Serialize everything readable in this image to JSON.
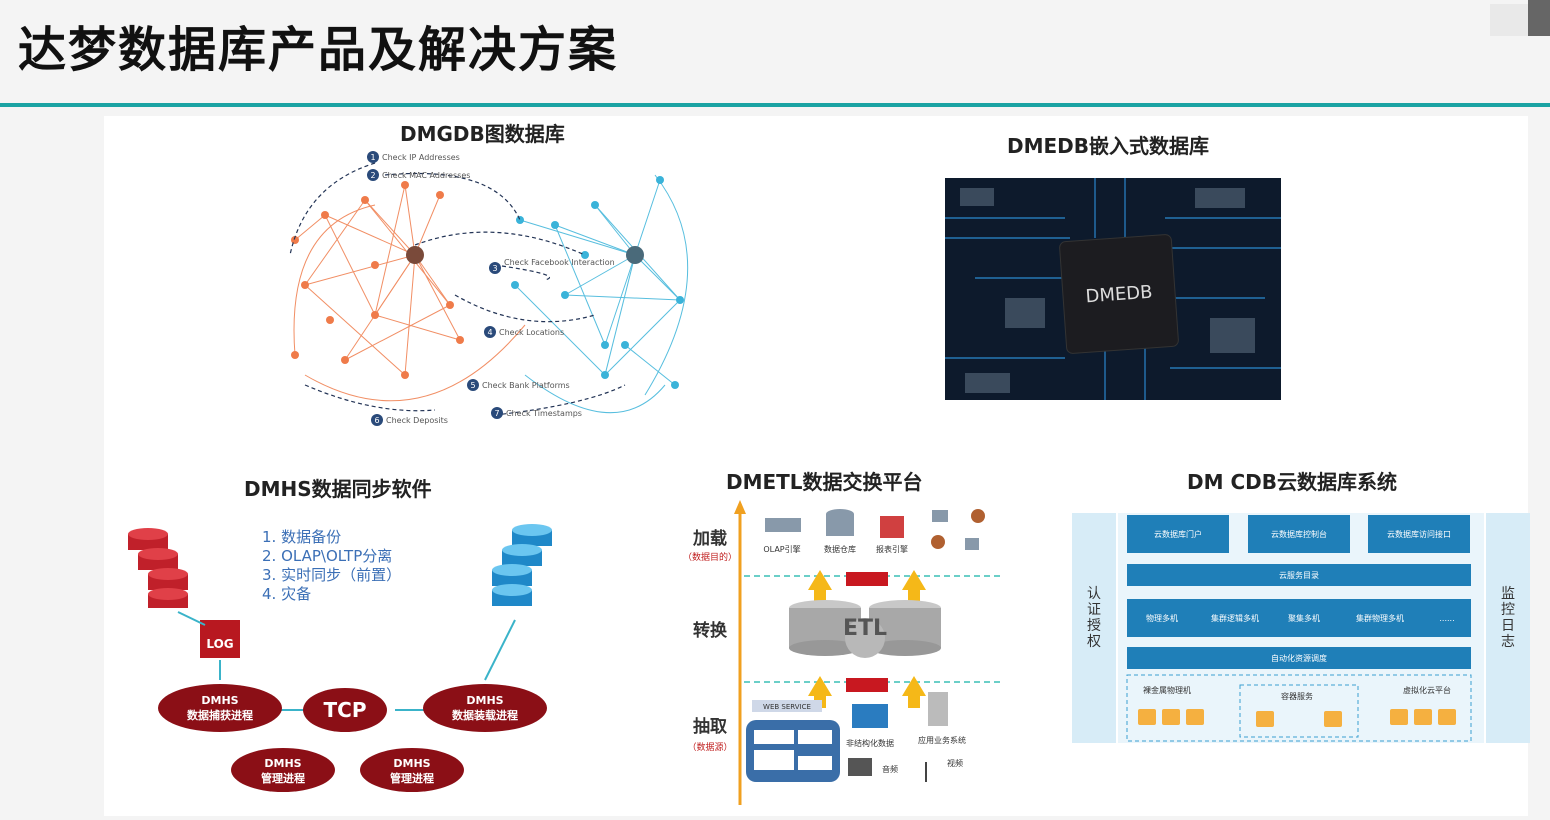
{
  "page": {
    "title": "达梦数据库产品及解决方案"
  },
  "dmgdb": {
    "title": "DMGDB图数据库",
    "steps": [
      "Check IP Addresses",
      "Check MAC Addresses",
      "Check Facebook Interaction",
      "Check Locations",
      "Check Bank Platforms",
      "Check Deposits",
      "Check Timestamps"
    ],
    "step_numbers": [
      "1",
      "2",
      "3",
      "4",
      "5",
      "6",
      "7"
    ]
  },
  "dmedb": {
    "title": "DMEDB嵌入式数据库",
    "chip_label": "DMEDB"
  },
  "dmhs": {
    "title": "DMHS数据同步软件",
    "list": [
      "1.   数据备份",
      "2.   OLAP\\OLTP分离",
      "3.   实时同步（前置）",
      "4.   灾备"
    ],
    "log": "LOG",
    "capture": [
      "DMHS",
      "数据捕获进程"
    ],
    "tcp": "TCP",
    "load": [
      "DMHS",
      "数据装载进程"
    ],
    "mgmt1": [
      "DMHS",
      "管理进程"
    ],
    "mgmt2": [
      "DMHS",
      "管理进程"
    ]
  },
  "dmetl": {
    "title": "DMETL数据交换平台",
    "stages": [
      {
        "label": "加载",
        "sub": "（数据目的）"
      },
      {
        "label": "转换"
      },
      {
        "label": "抽取",
        "sub": "（数据源）"
      }
    ],
    "etl": "ETL",
    "load_items": [
      "OLAP引擎",
      "数据仓库",
      "报表引擎"
    ],
    "web_service": "WEB SERVICE",
    "source_items": [
      "非结构化数据",
      "应用业务系统",
      "音频",
      "视频"
    ]
  },
  "dmcdb": {
    "title": "DM CDB云数据库系统",
    "left": "认证授权",
    "right": "监控日志",
    "top_row": [
      "云数据库门户",
      "云数据库控制台",
      "云数据库访问接口"
    ],
    "service_bar": "云服务目录",
    "mid_row": [
      "物理多机",
      "集群逻辑多机",
      "聚集多机",
      "集群物理多机",
      "......"
    ],
    "sched_bar": "自动化资源调度",
    "bottom": [
      "裸金属物理机",
      "容器服务",
      "虚拟化云平台"
    ]
  },
  "colors": {
    "accent": "#1aa3a3",
    "cdb_blue": "#1f7fb8",
    "dmhs_red": "#8b0f16",
    "graph_orange": "#ef7b4a",
    "graph_cyan": "#3ab3d9"
  }
}
